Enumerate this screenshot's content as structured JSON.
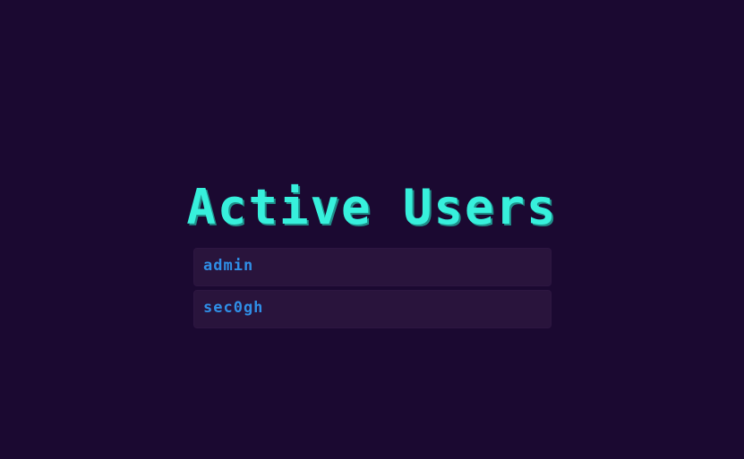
{
  "page": {
    "title": "Active Users"
  },
  "users": [
    {
      "name": "admin"
    },
    {
      "name": "sec0gh"
    }
  ],
  "colors": {
    "background": "#1b0931",
    "title": "#37f0dc",
    "row_background": "#29143c",
    "user_text": "#2f8ee6"
  }
}
